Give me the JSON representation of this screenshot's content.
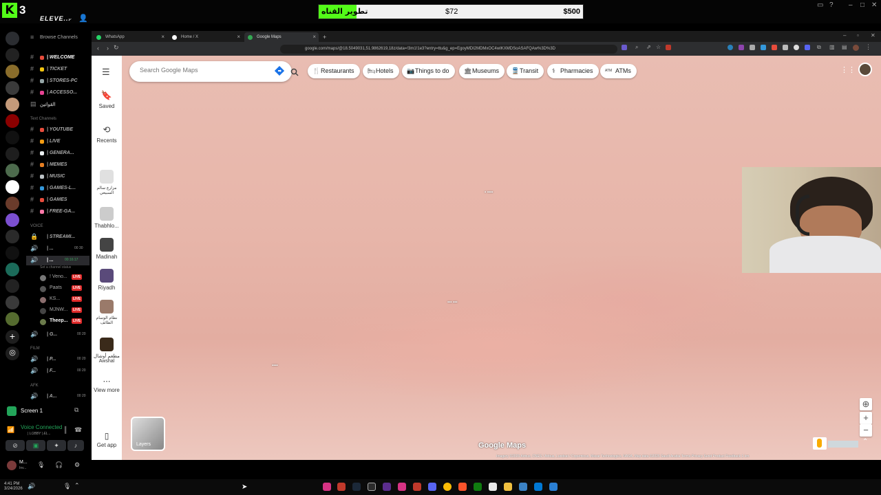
{
  "stream": {
    "logo_letter": "K",
    "counter": "3",
    "server_name": "ELEVE...",
    "goal": {
      "title": "تطوير القناه",
      "current": "$72",
      "target": "$500",
      "progress_fraction": 0.144
    }
  },
  "discord": {
    "browse_channels": "Browse Channels",
    "channels": [
      {
        "name": "| WELCOME",
        "color": "#e74c3c"
      },
      {
        "name": "| TICKET",
        "color": "#f1c40f"
      },
      {
        "name": "| STORES-PC",
        "color": "#95a5a6"
      },
      {
        "name": "| ACCESSO...",
        "color": "#e84393"
      },
      {
        "name": "القوانين",
        "color": "#777"
      }
    ],
    "text_section": "Text Channels",
    "text_channels": [
      {
        "name": "| YOUTUBE",
        "color": "#e74c3c"
      },
      {
        "name": "| LIVE",
        "color": "#f39c12"
      },
      {
        "name": "| GENERA...",
        "color": "#ecf0f1"
      },
      {
        "name": "| MEMES",
        "color": "#e67e22"
      },
      {
        "name": "| MUSIC",
        "color": "#bdc3c7"
      },
      {
        "name": "| GAMES-L...",
        "color": "#3498db"
      },
      {
        "name": "| GAMES",
        "color": "#e74c3c"
      },
      {
        "name": "| FREE-GA...",
        "color": "#fd79a8"
      }
    ],
    "voice_section": "VOICE",
    "voice_channels": [
      {
        "name": "| STREAMI...",
        "badge": ""
      },
      {
        "name": "| ...",
        "badge": "00 30"
      },
      {
        "name": "| ...",
        "badge": "00:16:17"
      }
    ],
    "channel_status": "Set a channel status",
    "voice_users": [
      {
        "name": "! Veno...",
        "live": "LIVE"
      },
      {
        "name": "Paats",
        "live": "LIVE"
      },
      {
        "name": "KS...",
        "live": "LIVE"
      },
      {
        "name": "MJNW...",
        "live": "LIVE"
      },
      {
        "name": "Theep...",
        "live": "LIVE"
      }
    ],
    "more_voice": [
      {
        "name": "| G...",
        "badge": "00 20"
      },
      {
        "name": "| P...",
        "badge": "00 20"
      },
      {
        "name": "| F...",
        "badge": "00 20"
      },
      {
        "name": "| A...",
        "badge": "00 20"
      }
    ],
    "film_section": "FILM",
    "afk_section": "AFK",
    "screen_label": "Screen 1",
    "voice_connected": "Voice Connected",
    "voice_channel_path": "| LOBBY | EL...",
    "user_name": "M...",
    "user_status": "Inv..."
  },
  "browser": {
    "tabs": [
      {
        "label": "WhatsApp",
        "color": "#25d366"
      },
      {
        "label": "Home / X",
        "color": "#ffffff"
      },
      {
        "label": "Google Maps",
        "color": "#34a853"
      }
    ],
    "new_tab": "+",
    "url": "google.com/maps/@18.5049031,51.9862619,18z/data=!3m1!1e3?entry=ttu&g_ep=EgoyMDI2MDMxOC4wIKXMDSoASAFQAw%3D%3D"
  },
  "maps": {
    "rail": [
      {
        "label": "Saved",
        "icon": "bookmark-icon"
      },
      {
        "label": "Recents",
        "icon": "history-icon"
      },
      {
        "label": "مزارع سالم السبيعي",
        "icon": "place-thumbnail"
      },
      {
        "label": "Thabhlo...",
        "icon": "place-thumbnail"
      },
      {
        "label": "Madinah",
        "icon": "place-thumbnail"
      },
      {
        "label": "Riyadh",
        "icon": "place-thumbnail"
      },
      {
        "label": "نطام الوسام الطائف",
        "icon": "place-thumbnail"
      },
      {
        "label": "مطعم أوشال Awshal",
        "icon": "place-thumbnail"
      },
      {
        "label": "View more",
        "icon": "more-icon"
      },
      {
        "label": "Get app",
        "icon": "phone-icon"
      }
    ],
    "search_placeholder": "Search Google Maps",
    "chips": [
      {
        "label": "Restaurants",
        "icon": "🍴"
      },
      {
        "label": "Hotels",
        "icon": "🛏"
      },
      {
        "label": "Things to do",
        "icon": "📷"
      },
      {
        "label": "Museums",
        "icon": "🏛"
      },
      {
        "label": "Transit",
        "icon": "🚆"
      },
      {
        "label": "Pharmacies",
        "icon": "⚕"
      },
      {
        "label": "ATMs",
        "icon": "ATM"
      }
    ],
    "layers_label": "Layers",
    "logo_text": "Google Maps",
    "attribution": "Imagery ©2026 Airbus, CNES / Airbus, Landsat / Copernicus, Maxar Technologies, NASA, Map data ©2026    Saudi Arabia    Terms    Privacy    Send Product Feedback    1 km"
  },
  "taskbar": {
    "time": "4:41 PM",
    "date": "3/24/2026"
  }
}
